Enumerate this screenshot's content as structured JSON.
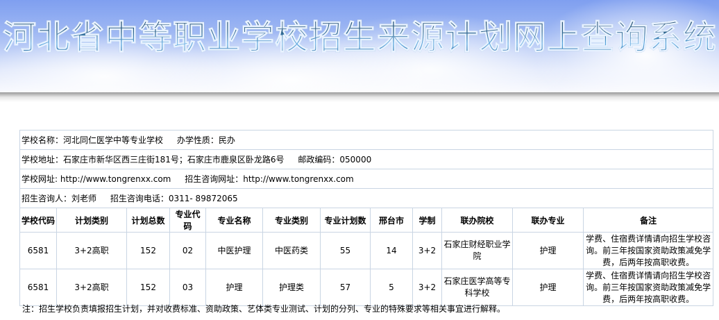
{
  "header": {
    "title": "河北省中等职业学校招生来源计划网上查询系统"
  },
  "school": {
    "name_label": "学校名称：",
    "name": "河北同仁医学中等专业学校",
    "nature_label": "办学性质：",
    "nature": "民办",
    "address_label": "学校地址：",
    "address": "石家庄市新华区西三庄街181号；石家庄市鹿泉区卧龙路6号",
    "postcode_label": "邮政编码：",
    "postcode": "050000",
    "website_label": "学校网址:",
    "website": "http://www.tongrenxx.com",
    "admission_site_label": "招生咨询网址：",
    "admission_site": "http://www.tongrenxx.com",
    "contact_label": "招生咨询人：",
    "contact": "刘老师",
    "phone_label": "招生咨询电话：",
    "phone": "0311- 89872065"
  },
  "table": {
    "columns": [
      "学校代码",
      "计划类别",
      "计划总数",
      "专业代码",
      "专业名称",
      "专业类别",
      "专业计划数",
      "邢台市",
      "学制",
      "联办院校",
      "联办专业",
      "备注"
    ],
    "rows": [
      [
        "6581",
        "3+2高职",
        "152",
        "02",
        "中医护理",
        "中医药类",
        "55",
        "14",
        "3+2",
        "石家庄财经职业学院",
        "护理",
        "学费、住宿费详情请向招生学校咨询。前三年按国家资助政策减免学费，后两年按高职收费。"
      ],
      [
        "6581",
        "3+2高职",
        "152",
        "03",
        "护理",
        "护理类",
        "57",
        "5",
        "3+2",
        "石家庄医学高等专科学校",
        "护理",
        "学费、住宿费详情请向招生学校咨询。前三年按国家资助政策减免学费，后两年按高职收费。"
      ]
    ]
  },
  "note": "注：招生学校负责填报招生计划，并对收费标准、资助政策、艺体类专业测试、计划的分列、专业的特殊要求等相关事宜进行解释。"
}
